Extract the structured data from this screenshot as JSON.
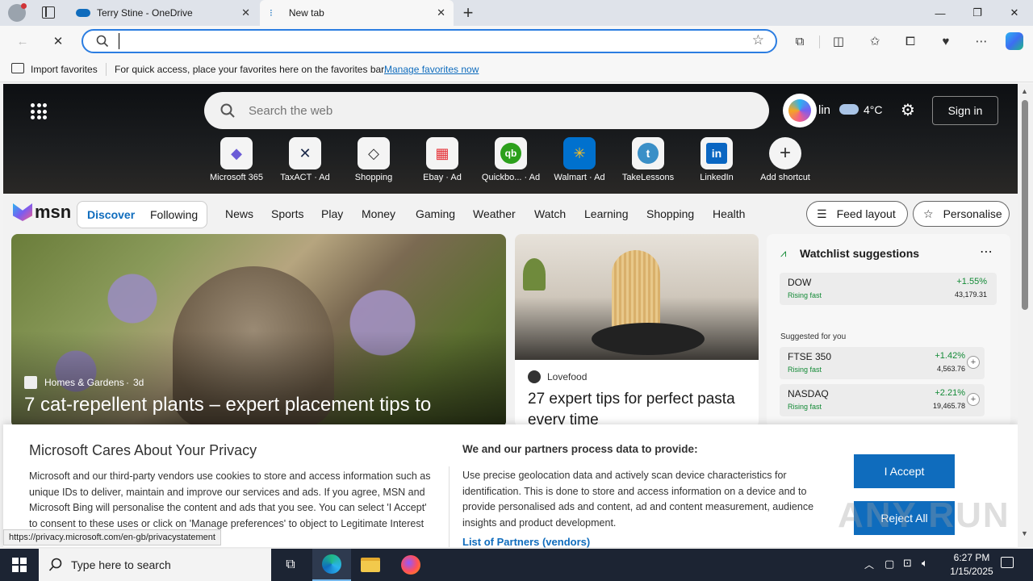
{
  "browser": {
    "tabs": [
      {
        "title": "Terry Stine - OneDrive",
        "active": false
      },
      {
        "title": "New tab",
        "active": true
      }
    ],
    "new_tab_glyph": "+",
    "window_controls": {
      "minimize": "—",
      "restore": "❐",
      "close": "✕"
    },
    "address_value": "",
    "favorites_bar": {
      "import_label": "Import favorites",
      "hint": "For quick access, place your favorites here on the favorites bar.",
      "manage_link": "Manage favorites now"
    }
  },
  "msn": {
    "search_placeholder": "Search the web",
    "user_short": "lin",
    "weather": "4°C",
    "sign_in": "Sign in",
    "shortcuts": [
      {
        "label": "Microsoft 365",
        "icon": "microsoft-365-icon",
        "glyph": "◆",
        "color": "#6b5bd6"
      },
      {
        "label": "TaxACT · Ad",
        "icon": "taxact-icon",
        "glyph": "✕",
        "color": "#1c2a4a"
      },
      {
        "label": "Shopping",
        "icon": "shopping-tag-icon",
        "glyph": "◇",
        "color": "#333333"
      },
      {
        "label": "Ebay · Ad",
        "icon": "ebay-icon",
        "glyph": "▦",
        "color": "#e53238"
      },
      {
        "label": "Quickbo... · Ad",
        "icon": "quickbooks-icon",
        "glyph": "qb",
        "color": "#2ca01c"
      },
      {
        "label": "Walmart · Ad",
        "icon": "walmart-icon",
        "glyph": "✳",
        "color": "#ffc220"
      },
      {
        "label": "TakeLessons",
        "icon": "takelessons-icon",
        "glyph": "t",
        "color": "#3a8fc7"
      },
      {
        "label": "LinkedIn",
        "icon": "linkedin-icon",
        "glyph": "in",
        "color": "#0a66c2"
      },
      {
        "label": "Add shortcut",
        "icon": "add-shortcut-icon",
        "glyph": "+",
        "color": "#333333"
      }
    ],
    "logo_text": "msn",
    "tabs": [
      "Discover",
      "Following"
    ],
    "nav": [
      "News",
      "Sports",
      "Play",
      "Money",
      "Gaming",
      "Weather",
      "Watch",
      "Learning",
      "Shopping",
      "Health"
    ],
    "feed_layout": "Feed layout",
    "personalise": "Personalise",
    "hero_card": {
      "source": "Homes & Gardens",
      "age": "3d",
      "headline": "7 cat-repellent plants – expert placement tips to"
    },
    "pasta_card": {
      "source": "Lovefood",
      "headline": "27 expert tips for perfect pasta every time"
    },
    "watchlist": {
      "title": "Watchlist suggestions",
      "top": {
        "symbol": "DOW",
        "status": "Rising fast",
        "change": "+1.55%",
        "price": "43,179.31"
      },
      "suggested_label": "Suggested for you",
      "suggested": [
        {
          "symbol": "FTSE 350",
          "status": "Rising fast",
          "change": "+1.42%",
          "price": "4,563.76"
        },
        {
          "symbol": "NASDAQ",
          "status": "Rising fast",
          "change": "+2.21%",
          "price": "19,465.78"
        }
      ]
    }
  },
  "privacy": {
    "title": "Microsoft Cares About Your Privacy",
    "body": "Microsoft and our third-party vendors use cookies to store and access information such as unique IDs to deliver, maintain and improve our services and ads. If you agree, MSN and Microsoft Bing will personalise the content and ads that you see. You can select 'I Accept' to consent to these uses or click on 'Manage preferences' to",
    "body_tail": "object to Legitimate Interest where",
    "right_title": "We and our partners process data to provide:",
    "right_body": "Use precise geolocation data and actively scan device characteristics for identification. This is done to store and access information on a device and to provide personalised ads and content, ad and content measurement, audience insights and product development.",
    "partners_link": "List of Partners (vendors)",
    "accept": "I Accept",
    "reject": "Reject All"
  },
  "status_url": "https://privacy.microsoft.com/en-gb/privacystatement",
  "watermark": "ANY RUN",
  "taskbar": {
    "search_placeholder": "Type here to search",
    "time": "6:27 PM",
    "date": "1/15/2025"
  },
  "colors": {
    "accent_blue": "#0f6cbd",
    "positive_green": "#138a36",
    "taskbar": "#1c2433"
  }
}
